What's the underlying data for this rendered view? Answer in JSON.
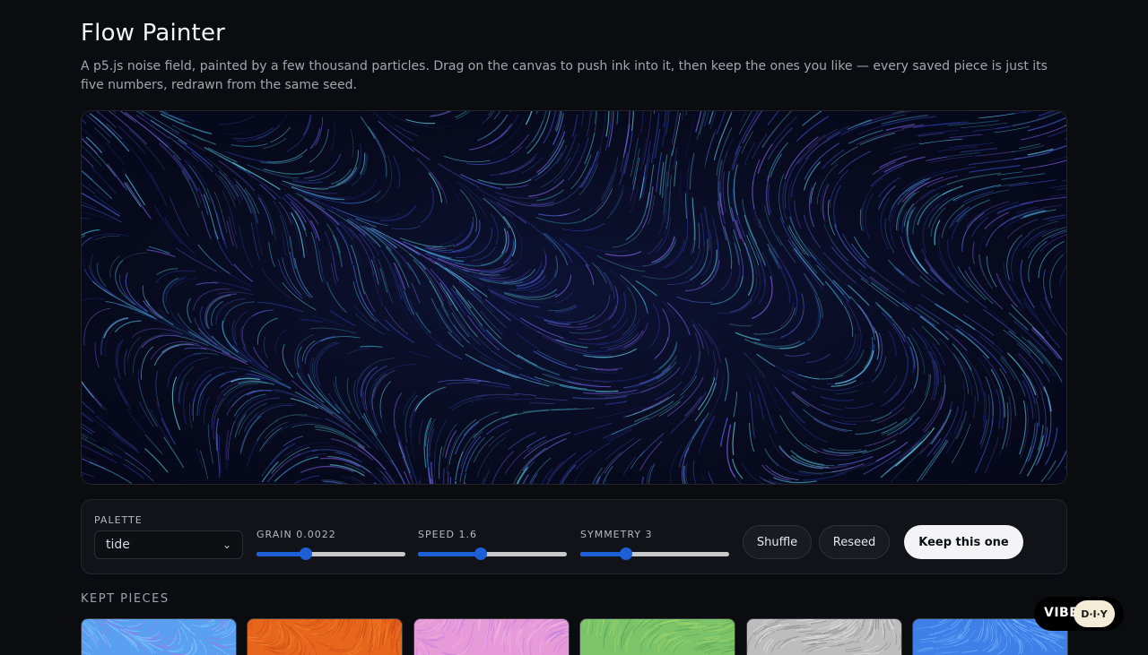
{
  "header": {
    "title": "Flow Painter",
    "description": "A p5.js noise field, painted by a few thousand particles. Drag on the canvas to push ink into it, then keep the ones you like — every saved piece is just its five numbers, redrawn from the same seed."
  },
  "controls": {
    "palette_label": "PALETTE",
    "palette_value": "tide",
    "grain_label": "GRAIN 0.0022",
    "grain_fraction": 0.33,
    "speed_label": "SPEED 1.6",
    "speed_fraction": 0.42,
    "symmetry_label": "SYMMETRY 3",
    "symmetry_fraction": 0.31,
    "shuffle_label": "Shuffle",
    "reseed_label": "Reseed",
    "keep_label": "Keep this one"
  },
  "kept": {
    "title": "KEPT PIECES",
    "pieces": [
      {
        "colors": [
          "#5aa0f0",
          "#7fc8ff",
          "#9c7ae8"
        ]
      },
      {
        "colors": [
          "#e8661c",
          "#f08a2a",
          "#c84a14"
        ]
      },
      {
        "colors": [
          "#e79ad8",
          "#f3b6e4",
          "#c77fe0"
        ]
      },
      {
        "colors": [
          "#7cc46a",
          "#a6d86a",
          "#5ea85a"
        ]
      },
      {
        "colors": [
          "#bdbdbd",
          "#e2e2e2",
          "#8f8f8f"
        ]
      },
      {
        "colors": [
          "#3f7fe8",
          "#5aa0f5",
          "#7ab8ff"
        ]
      }
    ]
  },
  "badge": {
    "text": "VIBE",
    "pill_text": "D·I·Y"
  },
  "canvas_colors": [
    "#2f3fa8",
    "#4a5fd0",
    "#3fa3c8",
    "#5fd0e0",
    "#7a5ad8",
    "#243089"
  ]
}
